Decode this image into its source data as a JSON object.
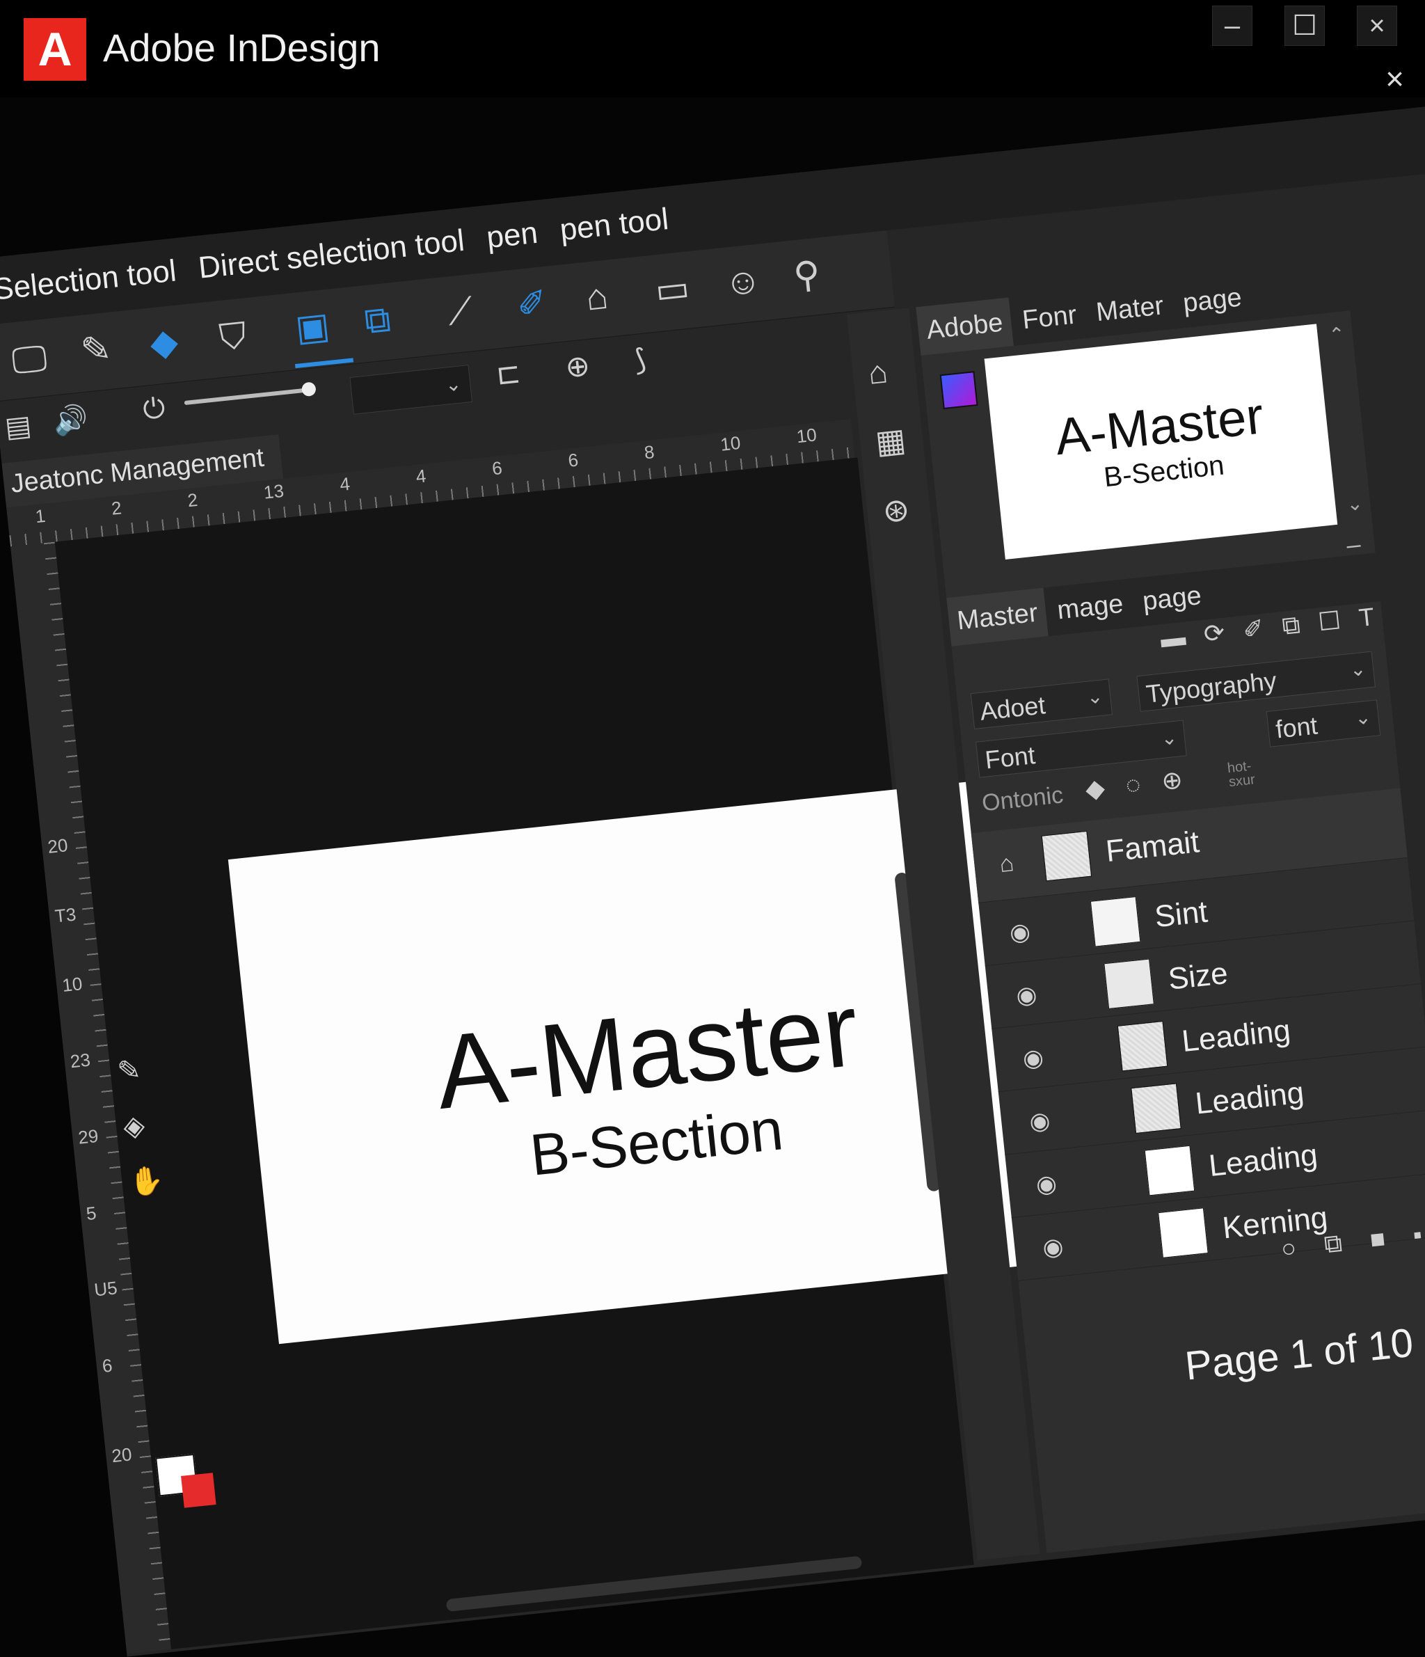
{
  "window": {
    "logo_letter": "A",
    "title": "Adobe InDesign",
    "controls": {
      "minimize": "–",
      "maximize": "☐",
      "close": "×"
    },
    "secondary_close": "×"
  },
  "menu": {
    "items": [
      "Selection tool",
      "Direct selection tool",
      "pen",
      "pen tool"
    ]
  },
  "document": {
    "tab_label": "Jeatonc Management",
    "ruler_h": [
      "1",
      "2",
      "2",
      "13",
      "4",
      "4",
      "6",
      "6",
      "8",
      "10",
      "10"
    ],
    "ruler_v": [
      "20",
      "T3",
      "10",
      "23",
      "29",
      "5",
      "U5",
      "6",
      "20"
    ],
    "page_title": "A-Master",
    "page_subtitle": "B-Section"
  },
  "panel": {
    "tabs_top": [
      "Adobe",
      "Fonr",
      "Mater",
      "page"
    ],
    "preview_title": "A-Master",
    "preview_subtitle": "B-Section",
    "tabs_bottom": [
      "Master",
      "mage",
      "page"
    ],
    "dropdowns": {
      "adobe": "Adoet",
      "typography": "Typography",
      "font": "Font",
      "font_small": "font"
    },
    "ontonic_label": "Ontonic",
    "hot_label": "hot- sxur",
    "layers": [
      {
        "label": "Famait",
        "group": true
      },
      {
        "label": "Sint"
      },
      {
        "label": "Size"
      },
      {
        "label": "Leading"
      },
      {
        "label": "Leading"
      },
      {
        "label": "Leading"
      },
      {
        "label": "Kerning"
      }
    ]
  },
  "status": {
    "page_indicator": "Page 1 of 10"
  },
  "colors": {
    "accent": "#2d8de3",
    "brand_red": "#e8261d",
    "stroke_swatch": "#e52b2b"
  }
}
